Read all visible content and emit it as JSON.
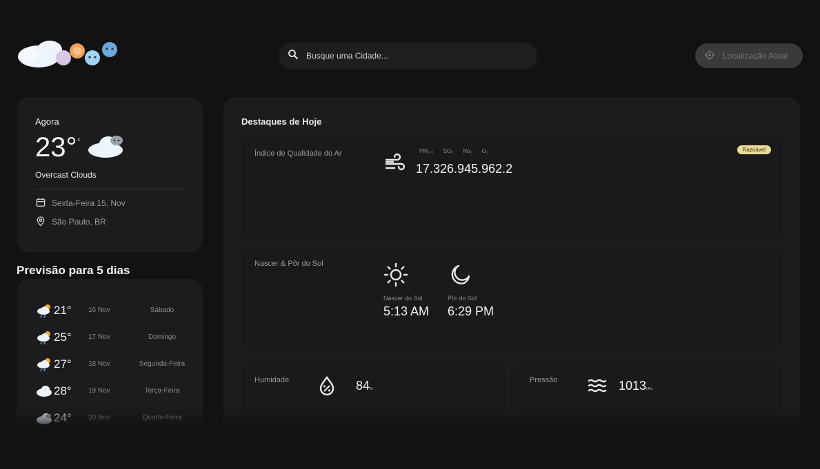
{
  "search": {
    "placeholder": "Busque uma Cidade..."
  },
  "location_button": {
    "label": "Localização Atual"
  },
  "current": {
    "label": "Agora",
    "temperature": "23°",
    "unit": "c",
    "description": "Overcast Clouds",
    "date": "Sexta-Feira 15, Nov",
    "location": "São Paulo, BR"
  },
  "forecast": {
    "title": "Previsão para 5 dias",
    "days": [
      {
        "temp": "21°",
        "date": "16 Nov",
        "day": "Sábado",
        "icon": "rain-sun-icon"
      },
      {
        "temp": "25°",
        "date": "17 Nov",
        "day": "Domingo",
        "icon": "rain-sun-icon"
      },
      {
        "temp": "27°",
        "date": "18 Nov",
        "day": "Segunda-Feira",
        "icon": "rain-sun-icon"
      },
      {
        "temp": "28°",
        "date": "19 Nov",
        "day": "Terça-Feira",
        "icon": "cloud-icon"
      },
      {
        "temp": "24°",
        "date": "20 Nov",
        "day": "Quarta-Feira",
        "icon": "cloud-icon"
      }
    ]
  },
  "highlights": {
    "title": "Destaques de Hoje",
    "aqi": {
      "label": "Índice de Qualidade do Ar",
      "badge": "Razoável",
      "pollutants": [
        "PM₂.₅",
        "SO₂",
        "No₂",
        "O₃"
      ],
      "values": "17.326.945.962.2"
    },
    "sun": {
      "label": "Nascer & Pôr do Sol",
      "sunrise_label": "Nascer do Sol",
      "sunrise": "5:13 AM",
      "sunset_label": "Pôr do Sol",
      "sunset": "6:29 PM"
    },
    "humidity": {
      "label": "Humidade",
      "value": "84",
      "unit": "%"
    },
    "pressure": {
      "label": "Pressão",
      "value": "1013",
      "unit": "hPa"
    }
  },
  "colors": {
    "background": "#121213",
    "card": "#1c1c1e",
    "badge": "#e9dd97"
  }
}
